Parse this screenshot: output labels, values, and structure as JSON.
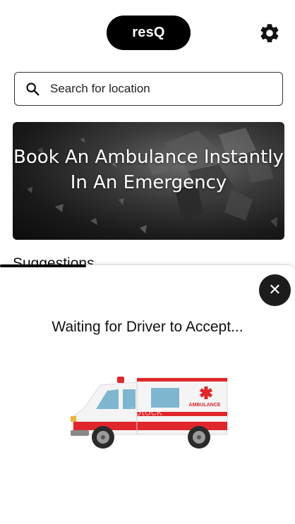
{
  "header": {
    "app_name": "resQ",
    "settings_icon": "gear-icon"
  },
  "search": {
    "placeholder": "Search for location",
    "icon": "search-icon"
  },
  "banner": {
    "line1": "Book An Ambulance Instantly",
    "line2": "In An Emergency"
  },
  "suggestions": {
    "title": "Suggestions"
  },
  "sheet": {
    "close_icon": "close-icon",
    "close_label": "✕",
    "status_text": "Waiting for Driver to Accept...",
    "illustration": "ambulance-illustration",
    "ambulance_label": "AMBULANCE",
    "watermark": "iStock"
  },
  "colors": {
    "ambulance_red": "#e0262b",
    "pill_bg": "#000000",
    "close_bg": "#1c1c1c"
  }
}
